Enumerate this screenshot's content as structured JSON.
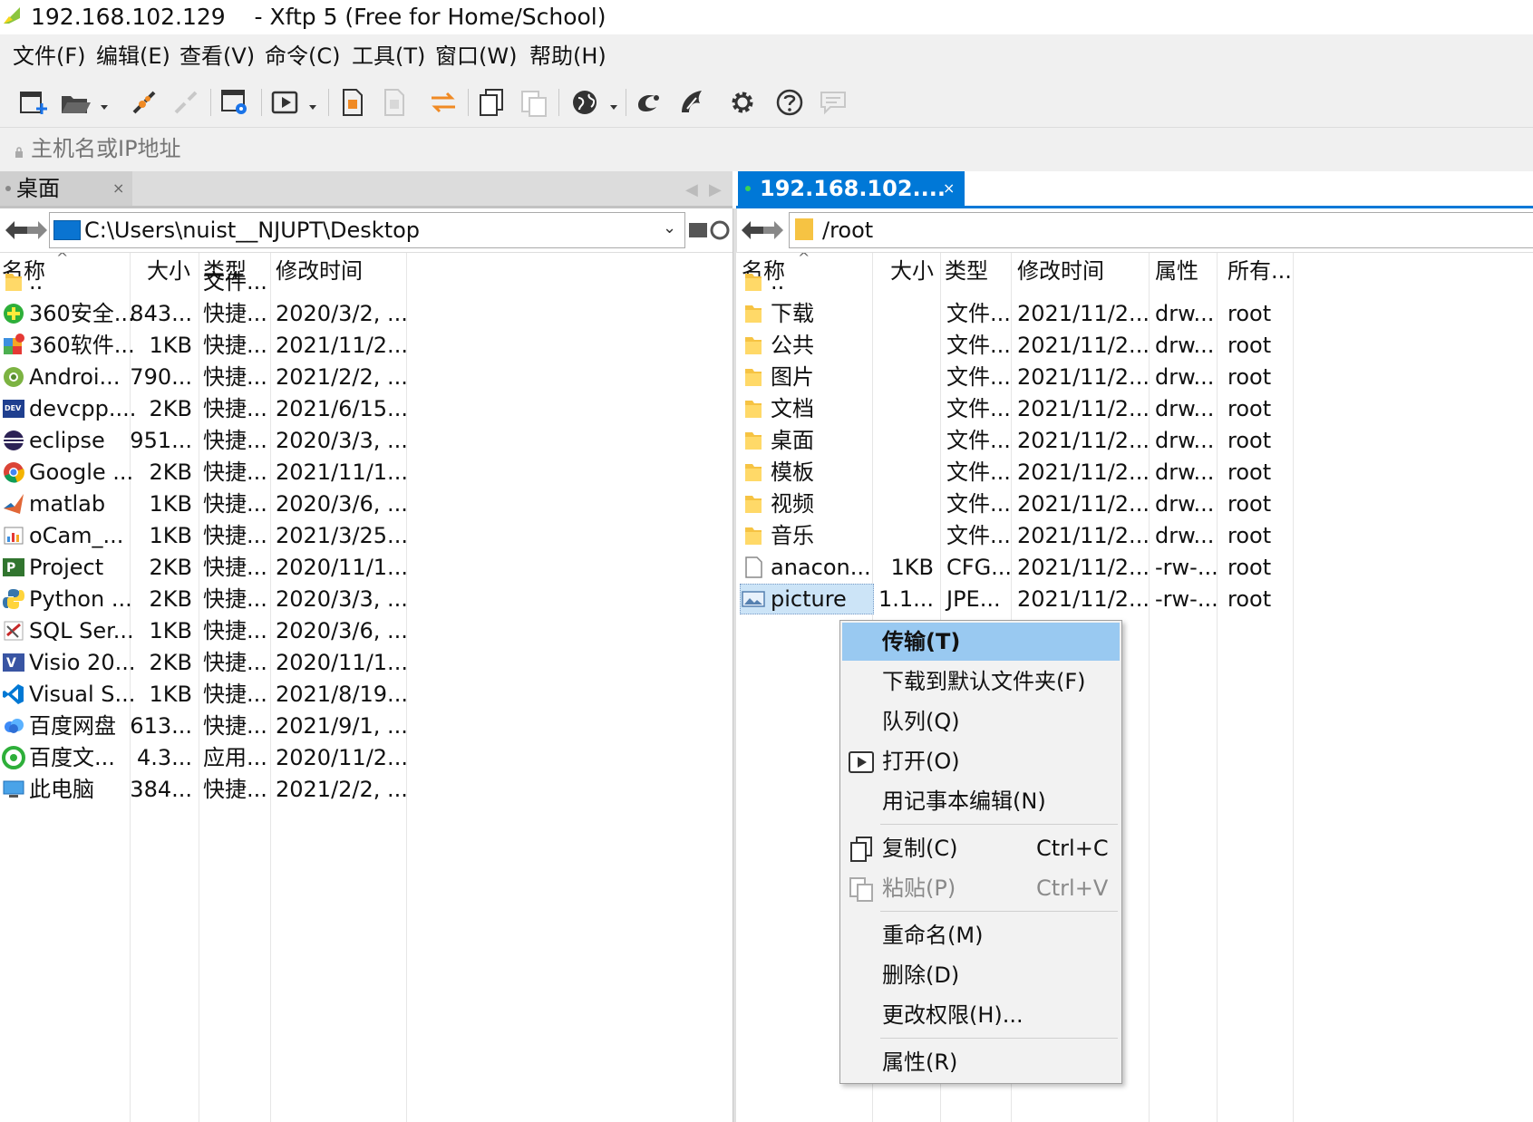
{
  "window": {
    "title": "192.168.102.129    - Xftp 5 (Free for Home/School)"
  },
  "menu": [
    "文件(F)",
    "编辑(E)",
    "查看(V)",
    "命令(C)",
    "工具(T)",
    "窗口(W)",
    "帮助(H)"
  ],
  "toolbar_icons": [
    "new-session-icon",
    "open-folder-icon",
    "connect-icon",
    "disconnect-icon",
    "session-properties-icon",
    "open-file-icon",
    "new-file-icon",
    "delete-file-icon",
    "sync-icon",
    "copy-icon",
    "paste-icon",
    "globe-icon",
    "xshell-icon",
    "xmanager-icon",
    "settings-icon",
    "help-icon",
    "chat-icon"
  ],
  "address": {
    "placeholder": "主机名或IP地址"
  },
  "left": {
    "tab_label": "桌面",
    "tab_close": "×",
    "path": "C:\\Users\\nuist__NJUPT\\Desktop",
    "headers": {
      "name": "名称",
      "size": "大小",
      "type": "类型",
      "modified": "修改时间"
    },
    "sort_arrow": "^",
    "rows": [
      {
        "name": "..",
        "size": "",
        "type": "文件...",
        "modified": "",
        "icon": "folder-icon"
      },
      {
        "name": "360安全...",
        "size": "843...",
        "type": "快捷...",
        "modified": "2020/3/2, ...",
        "icon": "360-security-icon"
      },
      {
        "name": "360软件...",
        "size": "1KB",
        "type": "快捷...",
        "modified": "2021/11/2...",
        "icon": "360-software-icon"
      },
      {
        "name": "Androi...",
        "size": "790...",
        "type": "快捷...",
        "modified": "2021/2/2, ...",
        "icon": "android-icon"
      },
      {
        "name": "devcpp....",
        "size": "2KB",
        "type": "快捷...",
        "modified": "2021/6/15...",
        "icon": "devcpp-icon"
      },
      {
        "name": "eclipse",
        "size": "951...",
        "type": "快捷...",
        "modified": "2020/3/3, ...",
        "icon": "eclipse-icon"
      },
      {
        "name": "Google ...",
        "size": "2KB",
        "type": "快捷...",
        "modified": "2021/11/1...",
        "icon": "chrome-icon"
      },
      {
        "name": "matlab",
        "size": "1KB",
        "type": "快捷...",
        "modified": "2020/3/6, ...",
        "icon": "matlab-icon"
      },
      {
        "name": "oCam_...",
        "size": "1KB",
        "type": "快捷...",
        "modified": "2021/3/25...",
        "icon": "ocam-icon"
      },
      {
        "name": "Project",
        "size": "2KB",
        "type": "快捷...",
        "modified": "2020/11/1...",
        "icon": "project-icon"
      },
      {
        "name": "Python ...",
        "size": "2KB",
        "type": "快捷...",
        "modified": "2020/3/3, ...",
        "icon": "python-icon"
      },
      {
        "name": "SQL Ser...",
        "size": "1KB",
        "type": "快捷...",
        "modified": "2020/3/6, ...",
        "icon": "sql-server-icon"
      },
      {
        "name": "Visio 20...",
        "size": "2KB",
        "type": "快捷...",
        "modified": "2020/11/1...",
        "icon": "visio-icon"
      },
      {
        "name": "Visual S...",
        "size": "1KB",
        "type": "快捷...",
        "modified": "2021/8/19...",
        "icon": "vscode-icon"
      },
      {
        "name": "百度网盘",
        "size": "613...",
        "type": "快捷...",
        "modified": "2021/9/1, ...",
        "icon": "baidu-netdisk-icon"
      },
      {
        "name": "百度文...",
        "size": "4.3...",
        "type": "应用...",
        "modified": "2020/11/2...",
        "icon": "baidu-wenku-icon"
      },
      {
        "name": "此电脑",
        "size": "384...",
        "type": "快捷...",
        "modified": "2021/2/2, ...",
        "icon": "computer-icon"
      }
    ]
  },
  "right": {
    "tab_label": "192.168.102....",
    "tab_close": "×",
    "path": "/root",
    "headers": {
      "name": "名称",
      "size": "大小",
      "type": "类型",
      "modified": "修改时间",
      "attr": "属性",
      "owner": "所有..."
    },
    "sort_arrow": "^",
    "rows": [
      {
        "name": "..",
        "size": "",
        "type": "",
        "modified": "",
        "attr": "",
        "owner": "",
        "icon": "folder-icon"
      },
      {
        "name": "下载",
        "size": "",
        "type": "文件...",
        "modified": "2021/11/2...",
        "attr": "drw...",
        "owner": "root",
        "icon": "folder-icon"
      },
      {
        "name": "公共",
        "size": "",
        "type": "文件...",
        "modified": "2021/11/2...",
        "attr": "drw...",
        "owner": "root",
        "icon": "folder-icon"
      },
      {
        "name": "图片",
        "size": "",
        "type": "文件...",
        "modified": "2021/11/2...",
        "attr": "drw...",
        "owner": "root",
        "icon": "folder-icon"
      },
      {
        "name": "文档",
        "size": "",
        "type": "文件...",
        "modified": "2021/11/2...",
        "attr": "drw...",
        "owner": "root",
        "icon": "folder-icon"
      },
      {
        "name": "桌面",
        "size": "",
        "type": "文件...",
        "modified": "2021/11/2...",
        "attr": "drw...",
        "owner": "root",
        "icon": "folder-icon"
      },
      {
        "name": "模板",
        "size": "",
        "type": "文件...",
        "modified": "2021/11/2...",
        "attr": "drw...",
        "owner": "root",
        "icon": "folder-icon"
      },
      {
        "name": "视频",
        "size": "",
        "type": "文件...",
        "modified": "2021/11/2...",
        "attr": "drw...",
        "owner": "root",
        "icon": "folder-icon"
      },
      {
        "name": "音乐",
        "size": "",
        "type": "文件...",
        "modified": "2021/11/2...",
        "attr": "drw...",
        "owner": "root",
        "icon": "folder-icon"
      },
      {
        "name": "anacon...",
        "size": "1KB",
        "type": "CFG...",
        "modified": "2021/11/2...",
        "attr": "-rw-...",
        "owner": "root",
        "icon": "file-icon"
      },
      {
        "name": "picture",
        "size": "1.1...",
        "type": "JPE...",
        "modified": "2021/11/2...",
        "attr": "-rw-...",
        "owner": "root",
        "icon": "image-file-icon"
      }
    ]
  },
  "context_menu": {
    "items": [
      {
        "label": "传输(T)",
        "shortcut": "",
        "icon": "",
        "highlighted": true,
        "disabled": false,
        "bold": true
      },
      {
        "label": "下载到默认文件夹(F)",
        "shortcut": "",
        "icon": "",
        "highlighted": false,
        "disabled": false
      },
      {
        "label": "队列(Q)",
        "shortcut": "",
        "icon": "",
        "highlighted": false,
        "disabled": false
      },
      {
        "label": "打开(O)",
        "shortcut": "",
        "icon": "open-play-icon",
        "highlighted": false,
        "disabled": false
      },
      {
        "label": "用记事本编辑(N)",
        "shortcut": "",
        "icon": "",
        "highlighted": false,
        "disabled": false
      },
      {
        "label": "复制(C)",
        "shortcut": "Ctrl+C",
        "icon": "copy-icon",
        "highlighted": false,
        "disabled": false
      },
      {
        "label": "粘贴(P)",
        "shortcut": "Ctrl+V",
        "icon": "paste-icon",
        "highlighted": false,
        "disabled": true
      },
      {
        "label": "重命名(M)",
        "shortcut": "",
        "icon": "",
        "highlighted": false,
        "disabled": false
      },
      {
        "label": "删除(D)",
        "shortcut": "",
        "icon": "",
        "highlighted": false,
        "disabled": false
      },
      {
        "label": "更改权限(H)...",
        "shortcut": "",
        "icon": "",
        "highlighted": false,
        "disabled": false
      },
      {
        "label": "属性(R)",
        "shortcut": "",
        "icon": "",
        "highlighted": false,
        "disabled": false
      }
    ]
  },
  "colors": {
    "accent": "#0078d7",
    "menu_highlight": "#99c9f1",
    "chrome": "#f0f0f0",
    "folder": "#f6c343"
  }
}
